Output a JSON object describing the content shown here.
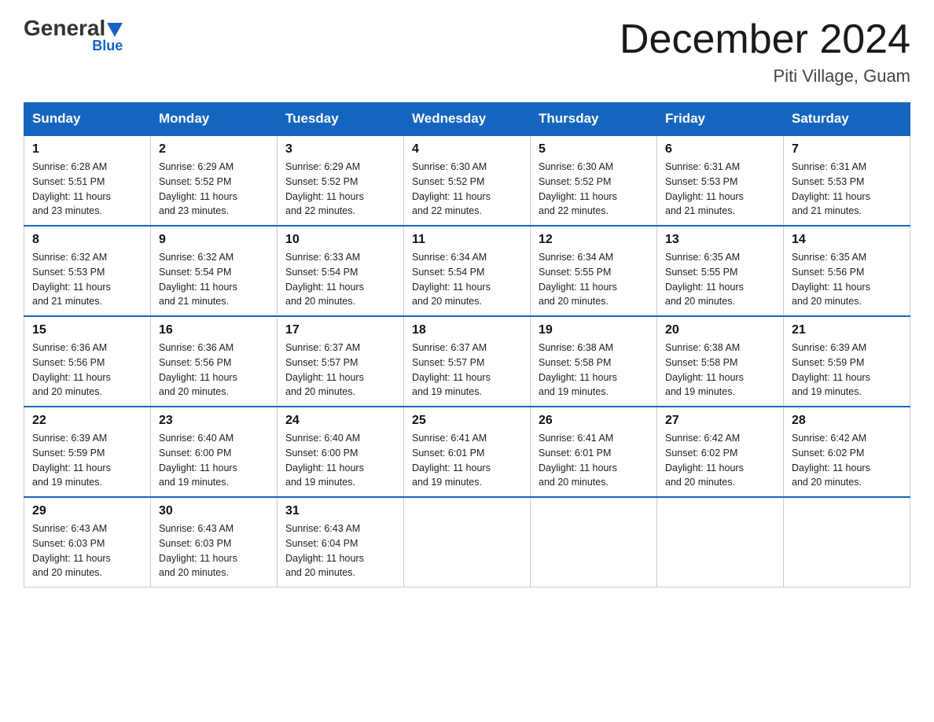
{
  "header": {
    "logo_general": "General",
    "logo_blue": "Blue",
    "month_title": "December 2024",
    "location": "Piti Village, Guam"
  },
  "days_of_week": [
    "Sunday",
    "Monday",
    "Tuesday",
    "Wednesday",
    "Thursday",
    "Friday",
    "Saturday"
  ],
  "weeks": [
    [
      {
        "day": "1",
        "sunrise": "6:28 AM",
        "sunset": "5:51 PM",
        "daylight": "11 hours and 23 minutes."
      },
      {
        "day": "2",
        "sunrise": "6:29 AM",
        "sunset": "5:52 PM",
        "daylight": "11 hours and 23 minutes."
      },
      {
        "day": "3",
        "sunrise": "6:29 AM",
        "sunset": "5:52 PM",
        "daylight": "11 hours and 22 minutes."
      },
      {
        "day": "4",
        "sunrise": "6:30 AM",
        "sunset": "5:52 PM",
        "daylight": "11 hours and 22 minutes."
      },
      {
        "day": "5",
        "sunrise": "6:30 AM",
        "sunset": "5:52 PM",
        "daylight": "11 hours and 22 minutes."
      },
      {
        "day": "6",
        "sunrise": "6:31 AM",
        "sunset": "5:53 PM",
        "daylight": "11 hours and 21 minutes."
      },
      {
        "day": "7",
        "sunrise": "6:31 AM",
        "sunset": "5:53 PM",
        "daylight": "11 hours and 21 minutes."
      }
    ],
    [
      {
        "day": "8",
        "sunrise": "6:32 AM",
        "sunset": "5:53 PM",
        "daylight": "11 hours and 21 minutes."
      },
      {
        "day": "9",
        "sunrise": "6:32 AM",
        "sunset": "5:54 PM",
        "daylight": "11 hours and 21 minutes."
      },
      {
        "day": "10",
        "sunrise": "6:33 AM",
        "sunset": "5:54 PM",
        "daylight": "11 hours and 20 minutes."
      },
      {
        "day": "11",
        "sunrise": "6:34 AM",
        "sunset": "5:54 PM",
        "daylight": "11 hours and 20 minutes."
      },
      {
        "day": "12",
        "sunrise": "6:34 AM",
        "sunset": "5:55 PM",
        "daylight": "11 hours and 20 minutes."
      },
      {
        "day": "13",
        "sunrise": "6:35 AM",
        "sunset": "5:55 PM",
        "daylight": "11 hours and 20 minutes."
      },
      {
        "day": "14",
        "sunrise": "6:35 AM",
        "sunset": "5:56 PM",
        "daylight": "11 hours and 20 minutes."
      }
    ],
    [
      {
        "day": "15",
        "sunrise": "6:36 AM",
        "sunset": "5:56 PM",
        "daylight": "11 hours and 20 minutes."
      },
      {
        "day": "16",
        "sunrise": "6:36 AM",
        "sunset": "5:56 PM",
        "daylight": "11 hours and 20 minutes."
      },
      {
        "day": "17",
        "sunrise": "6:37 AM",
        "sunset": "5:57 PM",
        "daylight": "11 hours and 20 minutes."
      },
      {
        "day": "18",
        "sunrise": "6:37 AM",
        "sunset": "5:57 PM",
        "daylight": "11 hours and 19 minutes."
      },
      {
        "day": "19",
        "sunrise": "6:38 AM",
        "sunset": "5:58 PM",
        "daylight": "11 hours and 19 minutes."
      },
      {
        "day": "20",
        "sunrise": "6:38 AM",
        "sunset": "5:58 PM",
        "daylight": "11 hours and 19 minutes."
      },
      {
        "day": "21",
        "sunrise": "6:39 AM",
        "sunset": "5:59 PM",
        "daylight": "11 hours and 19 minutes."
      }
    ],
    [
      {
        "day": "22",
        "sunrise": "6:39 AM",
        "sunset": "5:59 PM",
        "daylight": "11 hours and 19 minutes."
      },
      {
        "day": "23",
        "sunrise": "6:40 AM",
        "sunset": "6:00 PM",
        "daylight": "11 hours and 19 minutes."
      },
      {
        "day": "24",
        "sunrise": "6:40 AM",
        "sunset": "6:00 PM",
        "daylight": "11 hours and 19 minutes."
      },
      {
        "day": "25",
        "sunrise": "6:41 AM",
        "sunset": "6:01 PM",
        "daylight": "11 hours and 19 minutes."
      },
      {
        "day": "26",
        "sunrise": "6:41 AM",
        "sunset": "6:01 PM",
        "daylight": "11 hours and 20 minutes."
      },
      {
        "day": "27",
        "sunrise": "6:42 AM",
        "sunset": "6:02 PM",
        "daylight": "11 hours and 20 minutes."
      },
      {
        "day": "28",
        "sunrise": "6:42 AM",
        "sunset": "6:02 PM",
        "daylight": "11 hours and 20 minutes."
      }
    ],
    [
      {
        "day": "29",
        "sunrise": "6:43 AM",
        "sunset": "6:03 PM",
        "daylight": "11 hours and 20 minutes."
      },
      {
        "day": "30",
        "sunrise": "6:43 AM",
        "sunset": "6:03 PM",
        "daylight": "11 hours and 20 minutes."
      },
      {
        "day": "31",
        "sunrise": "6:43 AM",
        "sunset": "6:04 PM",
        "daylight": "11 hours and 20 minutes."
      },
      null,
      null,
      null,
      null
    ]
  ],
  "labels": {
    "sunrise": "Sunrise:",
    "sunset": "Sunset:",
    "daylight": "Daylight:"
  }
}
